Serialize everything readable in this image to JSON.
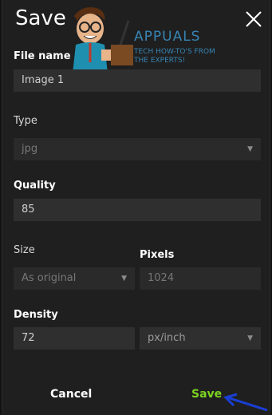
{
  "dialog": {
    "title": "Save",
    "close_icon": "close-icon"
  },
  "watermark": {
    "brand": "APPUALS",
    "tagline_line1": "TECH HOW-TO'S FROM",
    "tagline_line2": "THE EXPERTS!"
  },
  "file_name": {
    "label": "File name",
    "value": "Image 1"
  },
  "type": {
    "label": "Type",
    "value": "jpg"
  },
  "quality": {
    "label": "Quality",
    "value": "85"
  },
  "size": {
    "label": "Size",
    "value": "As original"
  },
  "pixels": {
    "label": "Pixels",
    "value": "1024"
  },
  "density": {
    "label": "Density",
    "value": "72",
    "unit": "px/inch"
  },
  "actions": {
    "cancel_label": "Cancel",
    "save_label": "Save"
  },
  "colors": {
    "save_accent": "#7dd321",
    "arrow": "#1a3fd6",
    "panel_bg": "#1f1f1f",
    "field_bg": "#2f2f2f"
  }
}
